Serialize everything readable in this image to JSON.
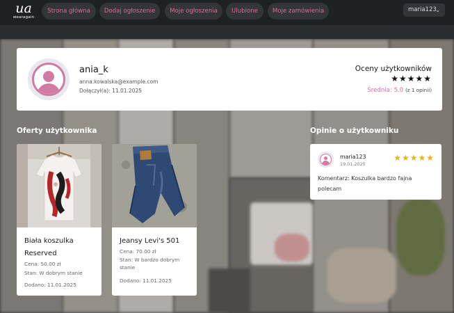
{
  "logo": {
    "mark": "ua",
    "wordmark": "wearagain"
  },
  "nav": {
    "items": [
      {
        "label": "Strona główna"
      },
      {
        "label": "Dodaj ogłoszenie"
      },
      {
        "label": "Moje ogłoszenia"
      },
      {
        "label": "Ulubione"
      },
      {
        "label": "Moje zamówienia"
      }
    ],
    "user_menu": "maria123",
    "user_menu_icon": "chevron-down-icon"
  },
  "profile": {
    "username": "ania_k",
    "email": "anna.kowalska@example.com",
    "joined": "Dołączył(a): 11.01.2025",
    "ratings_title": "Oceny użytkowników",
    "stars": "★★★★★",
    "average": "Średnia: 5.0",
    "count": "(z 1 opinii)"
  },
  "offers": {
    "title": "Oferty użytkownika",
    "items": [
      {
        "title": "Biała koszulka Reserved",
        "price": "Cena: 50.00 zł",
        "condition": "Stan: W dobrym stanie",
        "added": "Dodano: 11.01.2025",
        "image": "white-tshirt-photo"
      },
      {
        "title": "Jeansy Levi's 501",
        "price": "Cena: 70.00 zł",
        "condition": "Stan: W bardzo dobrym stanie",
        "added": "Dodano: 11.01.2025",
        "image": "jeans-photo"
      }
    ]
  },
  "reviews": {
    "title": "Opinie o użytkowniku",
    "items": [
      {
        "user": "maria123",
        "date": "19.01.2025",
        "stars": "★★★★★",
        "comment_label": "Komentarz:",
        "comment": "Koszulka bardzo fajna polecam"
      }
    ]
  },
  "colors": {
    "accent": "#d46ea0",
    "navbar": "#1f2023",
    "star_gold": "#e8b21a"
  }
}
